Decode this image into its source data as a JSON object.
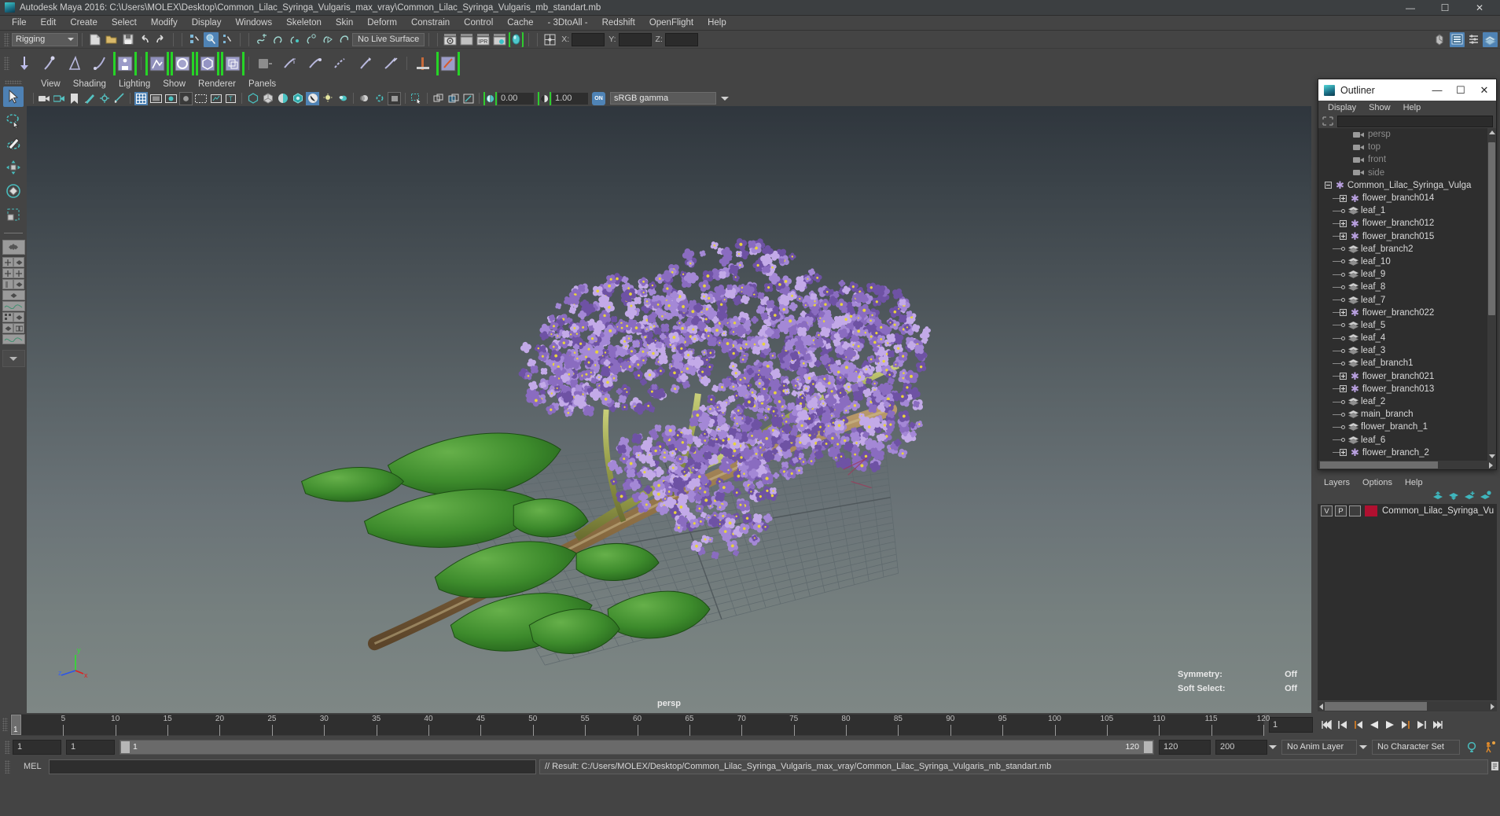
{
  "window": {
    "title": "Autodesk Maya 2016: C:\\Users\\MOLEX\\Desktop\\Common_Lilac_Syringa_Vulgaris_max_vray\\Common_Lilac_Syringa_Vulgaris_mb_standart.mb",
    "minimize": "—",
    "maximize": "☐",
    "close": "✕"
  },
  "menubar": [
    "File",
    "Edit",
    "Create",
    "Select",
    "Modify",
    "Display",
    "Windows",
    "Skeleton",
    "Skin",
    "Deform",
    "Constrain",
    "Control",
    "Cache",
    "- 3DtoAll -",
    "Redshift",
    "OpenFlight",
    "Help"
  ],
  "statusline": {
    "menuset": "Rigging",
    "live_surface": "No Live Surface",
    "ipr_label": "IPR",
    "coord_labels": {
      "x": "X:",
      "y": "Y:",
      "z": "Z:"
    },
    "coord_values": {
      "x": "",
      "y": "",
      "z": ""
    }
  },
  "viewport": {
    "menus": [
      "View",
      "Shading",
      "Lighting",
      "Show",
      "Renderer",
      "Panels"
    ],
    "exposure": "0.00",
    "gamma": "1.00",
    "on_badge": "ON",
    "color_space": "sRGB gamma",
    "camera_label": "persp",
    "stats": [
      {
        "key": "Symmetry:",
        "value": "Off"
      },
      {
        "key": "Soft Select:",
        "value": "Off"
      }
    ],
    "axis": {
      "x": "x",
      "y": "y",
      "z": "z"
    }
  },
  "outliner": {
    "title": "Outliner",
    "menus": [
      "Display",
      "Show",
      "Help"
    ],
    "search_value": "",
    "search_placeholder": "",
    "items": [
      {
        "label": "persp",
        "type": "camera",
        "depth": 1,
        "dim": true,
        "toggle": "none"
      },
      {
        "label": "top",
        "type": "camera",
        "depth": 1,
        "dim": true,
        "toggle": "none"
      },
      {
        "label": "front",
        "type": "camera",
        "depth": 1,
        "dim": true,
        "toggle": "none"
      },
      {
        "label": "side",
        "type": "camera",
        "depth": 1,
        "dim": true,
        "toggle": "none"
      },
      {
        "label": "Common_Lilac_Syringa_Vulga",
        "type": "group",
        "depth": 0,
        "dim": false,
        "toggle": "minus"
      },
      {
        "label": "flower_branch014",
        "type": "group",
        "depth": 1,
        "dim": false,
        "toggle": "plus"
      },
      {
        "label": "leaf_1",
        "type": "mesh",
        "depth": 1,
        "dim": false,
        "toggle": "dot"
      },
      {
        "label": "flower_branch012",
        "type": "group",
        "depth": 1,
        "dim": false,
        "toggle": "plus"
      },
      {
        "label": "flower_branch015",
        "type": "group",
        "depth": 1,
        "dim": false,
        "toggle": "plus"
      },
      {
        "label": "leaf_branch2",
        "type": "mesh",
        "depth": 1,
        "dim": false,
        "toggle": "dot"
      },
      {
        "label": "leaf_10",
        "type": "mesh",
        "depth": 1,
        "dim": false,
        "toggle": "dot"
      },
      {
        "label": "leaf_9",
        "type": "mesh",
        "depth": 1,
        "dim": false,
        "toggle": "dot"
      },
      {
        "label": "leaf_8",
        "type": "mesh",
        "depth": 1,
        "dim": false,
        "toggle": "dot"
      },
      {
        "label": "leaf_7",
        "type": "mesh",
        "depth": 1,
        "dim": false,
        "toggle": "dot"
      },
      {
        "label": "flower_branch022",
        "type": "group",
        "depth": 1,
        "dim": false,
        "toggle": "plus"
      },
      {
        "label": "leaf_5",
        "type": "mesh",
        "depth": 1,
        "dim": false,
        "toggle": "dot"
      },
      {
        "label": "leaf_4",
        "type": "mesh",
        "depth": 1,
        "dim": false,
        "toggle": "dot"
      },
      {
        "label": "leaf_3",
        "type": "mesh",
        "depth": 1,
        "dim": false,
        "toggle": "dot"
      },
      {
        "label": "leaf_branch1",
        "type": "mesh",
        "depth": 1,
        "dim": false,
        "toggle": "dot"
      },
      {
        "label": "flower_branch021",
        "type": "group",
        "depth": 1,
        "dim": false,
        "toggle": "plus"
      },
      {
        "label": "flower_branch013",
        "type": "group",
        "depth": 1,
        "dim": false,
        "toggle": "plus"
      },
      {
        "label": "leaf_2",
        "type": "mesh",
        "depth": 1,
        "dim": false,
        "toggle": "dot"
      },
      {
        "label": "main_branch",
        "type": "mesh",
        "depth": 1,
        "dim": false,
        "toggle": "dot"
      },
      {
        "label": "flower_branch_1",
        "type": "mesh",
        "depth": 1,
        "dim": false,
        "toggle": "dot"
      },
      {
        "label": "leaf_6",
        "type": "mesh",
        "depth": 1,
        "dim": false,
        "toggle": "dot"
      },
      {
        "label": "flower_branch_2",
        "type": "group",
        "depth": 1,
        "dim": false,
        "toggle": "plus"
      }
    ]
  },
  "layers": {
    "menus": [
      "Layers",
      "Options",
      "Help"
    ],
    "row": {
      "visibility": "V",
      "playback": "P",
      "shading": "",
      "color": "#b01030",
      "name": "Common_Lilac_Syringa_Vu"
    }
  },
  "timeline": {
    "ticks": [
      5,
      10,
      15,
      20,
      25,
      30,
      35,
      40,
      45,
      50,
      55,
      60,
      65,
      70,
      75,
      80,
      85,
      90,
      95,
      100,
      105,
      110,
      115,
      120
    ],
    "current_frame": "1",
    "current_frame_field": "1",
    "range_start": "1",
    "range_end": "1",
    "range_bar_start": "1",
    "range_bar_end": "120",
    "playback_end": "120",
    "animation_end": "200",
    "anim_layer": "No Anim Layer",
    "character_set": "No Character Set"
  },
  "command_line": {
    "label": "MEL",
    "input_value": "",
    "input_placeholder": "",
    "result": "// Result: C:/Users/MOLEX/Desktop/Common_Lilac_Syringa_Vulgaris_max_vray/Common_Lilac_Syringa_Vulgaris_mb_standart.mb"
  },
  "colors": {
    "accent_blue": "#4f83b5",
    "teal": "#2fb9bd",
    "green_bracket": "#2ecc2e",
    "layer_red": "#b01030"
  },
  "scene": {
    "model": "Common Lilac (Syringa Vulgaris) branch",
    "flower_color": "#9b7bc8",
    "leaf_color": "#3f8a2e",
    "stem_color": "#8f9240"
  }
}
